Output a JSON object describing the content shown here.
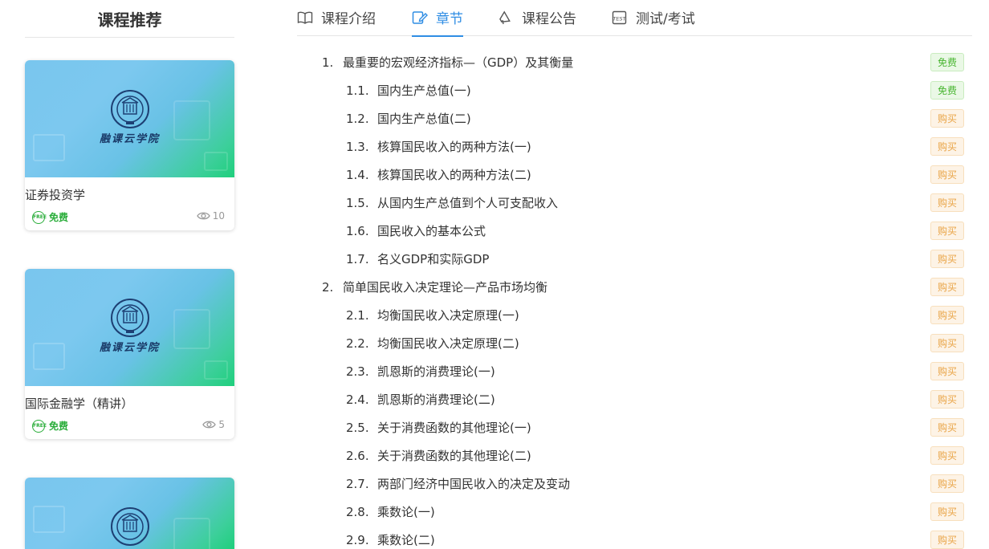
{
  "sidebar": {
    "title": "课程推荐",
    "cards": [
      {
        "name": "证券投资学",
        "price": "免费",
        "views": "10",
        "brand": "融课云学院"
      },
      {
        "name": "国际金融学（精讲）",
        "price": "免费",
        "views": "5",
        "brand": "融课云学院"
      },
      {
        "name": "",
        "price": "",
        "views": "",
        "brand": ""
      }
    ]
  },
  "tabs": [
    {
      "label": "课程介绍",
      "icon": "book-open-icon",
      "active": false
    },
    {
      "label": "章节",
      "icon": "edit-doc-icon",
      "active": true
    },
    {
      "label": "课程公告",
      "icon": "megaphone-icon",
      "active": false
    },
    {
      "label": "测试/考试",
      "icon": "test-paper-icon",
      "active": false
    }
  ],
  "chapters": [
    {
      "level": 1,
      "num": "1.",
      "title": "最重要的宏观经济指标—（GDP）及其衡量",
      "badge": "免费",
      "type": "free"
    },
    {
      "level": 2,
      "num": "1.1.",
      "title": "国内生产总值(一)",
      "badge": "免费",
      "type": "free"
    },
    {
      "level": 2,
      "num": "1.2.",
      "title": "国内生产总值(二)",
      "badge": "购买",
      "type": "buy"
    },
    {
      "level": 2,
      "num": "1.3.",
      "title": "核算国民收入的两种方法(一)",
      "badge": "购买",
      "type": "buy"
    },
    {
      "level": 2,
      "num": "1.4.",
      "title": "核算国民收入的两种方法(二)",
      "badge": "购买",
      "type": "buy"
    },
    {
      "level": 2,
      "num": "1.5.",
      "title": "从国内生产总值到个人可支配收入",
      "badge": "购买",
      "type": "buy"
    },
    {
      "level": 2,
      "num": "1.6.",
      "title": "国民收入的基本公式",
      "badge": "购买",
      "type": "buy"
    },
    {
      "level": 2,
      "num": "1.7.",
      "title": "名义GDP和实际GDP",
      "badge": "购买",
      "type": "buy"
    },
    {
      "level": 1,
      "num": "2.",
      "title": "简单国民收入决定理论—产品市场均衡",
      "badge": "购买",
      "type": "buy"
    },
    {
      "level": 2,
      "num": "2.1.",
      "title": "均衡国民收入决定原理(一)",
      "badge": "购买",
      "type": "buy"
    },
    {
      "level": 2,
      "num": "2.2.",
      "title": "均衡国民收入决定原理(二)",
      "badge": "购买",
      "type": "buy"
    },
    {
      "level": 2,
      "num": "2.3.",
      "title": "凯恩斯的消费理论(一)",
      "badge": "购买",
      "type": "buy"
    },
    {
      "level": 2,
      "num": "2.4.",
      "title": "凯恩斯的消费理论(二)",
      "badge": "购买",
      "type": "buy"
    },
    {
      "level": 2,
      "num": "2.5.",
      "title": "关于消费函数的其他理论(一)",
      "badge": "购买",
      "type": "buy"
    },
    {
      "level": 2,
      "num": "2.6.",
      "title": "关于消费函数的其他理论(二)",
      "badge": "购买",
      "type": "buy"
    },
    {
      "level": 2,
      "num": "2.7.",
      "title": "两部门经济中国民收入的决定及变动",
      "badge": "购买",
      "type": "buy"
    },
    {
      "level": 2,
      "num": "2.8.",
      "title": "乘数论(一)",
      "badge": "购买",
      "type": "buy"
    },
    {
      "level": 2,
      "num": "2.9.",
      "title": "乘数论(二)",
      "badge": "购买",
      "type": "buy"
    }
  ],
  "colors": {
    "accent": "#2f8de4",
    "free_green": "#47b52f",
    "buy_orange": "#e9a446"
  }
}
